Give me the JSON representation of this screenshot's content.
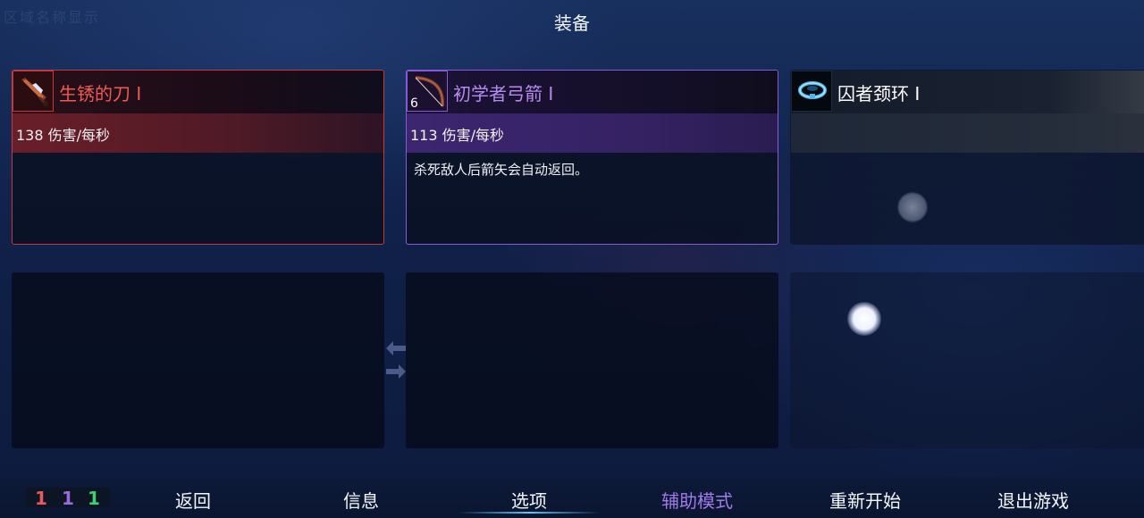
{
  "corner_text": "区域名称显示",
  "title": "装备",
  "slots": [
    {
      "name": "生锈的刀 Ⅰ",
      "stat": "138 伤害/每秒",
      "description": "",
      "level": "",
      "rarity_color": "#c8373a",
      "icon": "rusty-blade-icon"
    },
    {
      "name": "初学者弓箭 Ⅰ",
      "stat": "113 伤害/每秒",
      "description": "杀死敌人后箭矢会自动返回。",
      "level": "6",
      "rarity_color": "#8a5ad6",
      "icon": "bow-icon"
    },
    {
      "name": "囚者颈环 Ⅰ",
      "stat": "",
      "description": "",
      "level": "",
      "rarity_color": "#ffffff",
      "icon": "collar-icon"
    }
  ],
  "counters": [
    "1",
    "1",
    "1"
  ],
  "counter_colors": [
    "#e85a5a",
    "#9a6ae0",
    "#3ed070"
  ],
  "menu": {
    "back": "返回",
    "info": "信息",
    "options": "选项",
    "assist_mode": "辅助模式",
    "restart": "重新开始",
    "quit": "退出游戏",
    "selected": "选项"
  }
}
